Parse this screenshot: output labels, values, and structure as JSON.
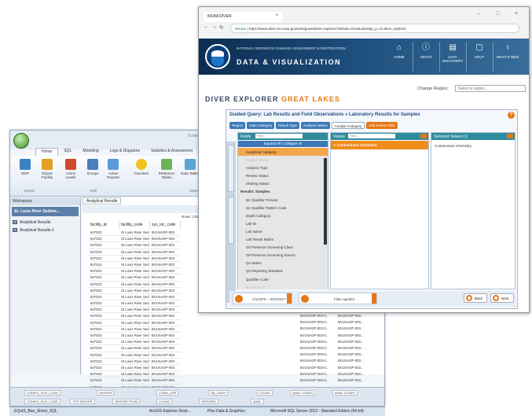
{
  "back_window": {
    "title": "Scribe",
    "ribbon_tabs": [
      "Home",
      "SQL",
      "Modeling",
      "Logs & Diagrams",
      "Statistics & Assessment"
    ],
    "ribbon_buttons": [
      {
        "label": "EDP",
        "icon": "edp-icon",
        "color": "#3b82c4"
      },
      {
        "label": "EQuIS Facility",
        "icon": "equis-facility-icon",
        "color": "#e0a020"
      },
      {
        "label": "Action Levels",
        "icon": "action-levels-icon",
        "color": "#d04a2a"
      },
      {
        "label": "Groups",
        "icon": "groups-icon",
        "color": "#4a7fc0"
      },
      {
        "label": "Active Reports",
        "icon": "active-reports-icon",
        "color": "#5a9ad8"
      },
      {
        "label": "Favorites",
        "icon": "favorites-star-icon",
        "color": "#f2c21b"
      },
      {
        "label": "Reference Tables",
        "icon": "reference-tables-icon",
        "color": "#6db35a"
      },
      {
        "label": "Data Tables",
        "icon": "data-tables-icon",
        "color": "#5ba5d6"
      }
    ],
    "ribbon_groups": [
      "Import",
      "Edit",
      "Open"
    ],
    "nav": {
      "header": "Workspace",
      "folder": "St. Louis River Sedime...",
      "items": [
        "Analytical Results",
        "Analytical Results-1"
      ]
    },
    "doc_tab": "Analytical Results",
    "rows_label": "Rows: 232 rows",
    "grid_columns": [
      "facility_id",
      "facility_code",
      "sys_loc_code"
    ],
    "grid_rows": [
      [
        "847023",
        "St Louis River Sed",
        "BVLNAGP-003"
      ],
      [
        "847023",
        "St Louis River Sed",
        "BVLNAGP-003"
      ],
      [
        "847023",
        "St Louis River Sed",
        "BVLNAGP-003"
      ],
      [
        "847023",
        "St Louis River Sed",
        "BVLNAGP-003"
      ],
      [
        "847023",
        "St Louis River Sed",
        "BVLNAGP-003"
      ],
      [
        "847023",
        "St Louis River Sed",
        "BVLNAGP-003"
      ],
      [
        "847023",
        "St Louis River Sed",
        "BVLNAGP-003"
      ],
      [
        "847023",
        "St Louis River Sed",
        "BVLNAGP-003"
      ],
      [
        "847023",
        "St Louis River Sed",
        "BVLNAGP-003"
      ],
      [
        "847023",
        "St Louis River Sed",
        "BVLNAGP-003"
      ],
      [
        "847023",
        "St Louis River Sed",
        "BVLNAGP-003"
      ],
      [
        "847023",
        "St Louis River Sed",
        "BVLNAGP-003"
      ],
      [
        "847023",
        "St Louis River Sed",
        "BVLNAGP-003"
      ],
      [
        "847023",
        "St Louis River Sed",
        "BVLNAGP-003"
      ],
      [
        "847023",
        "St Louis River Sed",
        "BVLNAGP-003"
      ],
      [
        "847023",
        "St Louis River Sed",
        "BVLNAGP-003"
      ],
      [
        "847023",
        "St Louis River Sed",
        "BVLNAGP-003"
      ],
      [
        "847023",
        "St Louis River Sed",
        "BVLNAGP-003"
      ],
      [
        "847023",
        "St Louis River Sed",
        "BVLNAGP-003"
      ],
      [
        "847023",
        "St Louis River Sed",
        "BVLNAGP-003"
      ],
      [
        "847023",
        "St Louis River Sed",
        "BVLNAGP-003"
      ],
      [
        "847023",
        "St Louis River Sed",
        "BVLNAGP-003"
      ],
      [
        "847023",
        "St Louis River Sed",
        "BVLNAGP-003"
      ],
      [
        "847023",
        "St Louis River Sed",
        "BVLNAGP-003"
      ],
      [
        "847023",
        "St Louis River Sed",
        "BVLNAGP-003"
      ]
    ],
    "right_rows": [
      [
        "BVLNAGP-003-0...",
        "BVLNAGP-003..."
      ],
      [
        "BVLNAGP-003-0...",
        "BVLNAGP-003..."
      ],
      [
        "BVLNAGP-003-0...",
        "BVLNAGP-003..."
      ],
      [
        "BVLNAGP-003-0...",
        "BVLNAGP-003..."
      ],
      [
        "BVLNAGP-003-0...",
        "BVLNAGP-003..."
      ],
      [
        "BVLNAGP-003-0...",
        "BVLNAGP-003..."
      ],
      [
        "BVLNAGP-003-0...",
        "BVLNAGP-003..."
      ],
      [
        "BVLNAGP-003-0...",
        "BVLNAGP-003..."
      ],
      [
        "BVLNAGP-003-0...",
        "BVLNAGP-003..."
      ],
      [
        "BVLNAGP-003-0...",
        "BVLNAGP-003..."
      ],
      [
        "BVLNAGP-003-0...",
        "BVLNAGP-003..."
      ]
    ],
    "bottom_fields": [
      "CONFIG_FILE_CODE",
      "SERVER",
      "CONN_USR",
      "DB_USER",
      "COUNT",
      "AVAIL CODES",
      "AVAIL CODES"
    ],
    "bottom_fields2": [
      "CONFIG_FILE_CODE",
      "TOP SERVER",
      "SERVER FROM",
      "COUNT",
      "SERVERS",
      "AVAIL"
    ]
  },
  "taskbar": {
    "items": [
      "EQuIS_Bas_Sheet_SQL",
      "ArcGIS Explorer Desk...",
      "Plus Data & Graphics",
      "Microsoft SQL Server 2012 - Standard Edition (64-bit)"
    ]
  },
  "browser": {
    "tab_title": "NOAA DIVER",
    "url_secure": "Secure",
    "url": "https://www.diver.orr.noaa.gov/web/guest/diver-explorer?default=GreatLakes&p_p_id=diver_explorer",
    "window_controls": [
      "–",
      "□",
      "×"
    ],
    "banner_sub": "NATIONAL RESOURCE DAMAGE ASSESSMENT & RESTORATION",
    "banner_title": "DATA & VISUALIZATION",
    "nav": [
      {
        "label": "HOME",
        "icon": "home-icon",
        "glyph": "⌂"
      },
      {
        "label": "ABOUT",
        "icon": "info-icon",
        "glyph": "ⓘ"
      },
      {
        "label": "DATA DISCOVERY",
        "icon": "data-discovery-icon",
        "glyph": "▤"
      },
      {
        "label": "HELP",
        "icon": "help-book-icon",
        "glyph": "▢"
      },
      {
        "label": "WHAT'S NEW",
        "icon": "lightbulb-icon",
        "glyph": "♀"
      }
    ],
    "change_region_label": "Change Region:",
    "region_placeholder": "Select a region...",
    "explorer_title": "DIVER EXPLORER",
    "explorer_region": "GREAT LAKES"
  },
  "guided_query": {
    "title": "Guided Query: Lab Results and Field Observations » Laboratory Results for Samples",
    "help": "?",
    "tabs": [
      "Region",
      "Data Category",
      "Result Type",
      "Analysis Status",
      "Analyte Category",
      "Add a New Filter"
    ],
    "fields_header": "Fields",
    "filter_placeholder": "Filter...",
    "fields_links": "Expand All | Collapse All",
    "field_items": [
      {
        "text": "Analytical Category",
        "kind": "hl"
      },
      {
        "text": "Analyte Name",
        "kind": "sub"
      },
      {
        "text": "Analysis Type",
        "kind": "normal"
      },
      {
        "text": "Review Status",
        "kind": "normal"
      },
      {
        "text": "Sharing Status",
        "kind": "normal"
      },
      {
        "text": "Results: Samples",
        "kind": "grp"
      },
      {
        "text": "Qc Qualifier Present",
        "kind": "normal"
      },
      {
        "text": "Qc Qualifier Pattern Code",
        "kind": "normal"
      },
      {
        "text": "Depth Category",
        "kind": "normal"
      },
      {
        "text": "Lab ID",
        "kind": "normal"
      },
      {
        "text": "Lab Name",
        "kind": "normal"
      },
      {
        "text": "Lab Result Matrix",
        "kind": "normal"
      },
      {
        "text": "Oil Presence Screening Class",
        "kind": "normal"
      },
      {
        "text": "Oil Presence Screening Source",
        "kind": "normal"
      },
      {
        "text": "QA Matrix",
        "kind": "normal"
      },
      {
        "text": "QA Reporting Standard",
        "kind": "normal"
      },
      {
        "text": "Qualifier Code",
        "kind": "normal"
      },
      {
        "text": "Result Units",
        "kind": "sub"
      }
    ],
    "values_header": "Values",
    "values_selected": "Contaminant Chemistry",
    "selected_header": "Selected Values (1)",
    "selected_item": "Contaminant Chemistry",
    "date_filter": "1/1/1878 – 3/10/2017",
    "applied_filter": "Filter applied",
    "back_label": "Back",
    "next_label": "Next"
  }
}
